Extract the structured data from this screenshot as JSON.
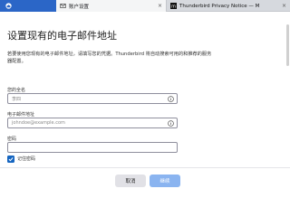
{
  "tabs": [
    {
      "label": "",
      "icon": "thunderbird-logo-icon",
      "active": false
    },
    {
      "label": "账户设置",
      "icon": "account-settings-icon",
      "active": true
    },
    {
      "label": "Thunderbird Privacy Notice — M",
      "icon": "mozilla-logo-icon",
      "active": false
    }
  ],
  "close_glyph": "×",
  "page": {
    "title": "设置现有的电子邮件地址",
    "description": "若要使用您现有的电子邮件地址，请填写您的凭据。Thunderbird 将自动搜索可用的和推荐的服务器配置。"
  },
  "form": {
    "name_label": "您的全名",
    "name_placeholder": "李四",
    "email_label": "电子邮件地址",
    "email_placeholder": "johndoe@example.com",
    "password_label": "密码",
    "password_value": "",
    "remember_label": "记住密码",
    "remember_checked": true
  },
  "buttons": {
    "cancel": "取消",
    "continue": "继续"
  },
  "colors": {
    "accent": "#1565c0",
    "continue_disabled": "#8ab4f0"
  }
}
